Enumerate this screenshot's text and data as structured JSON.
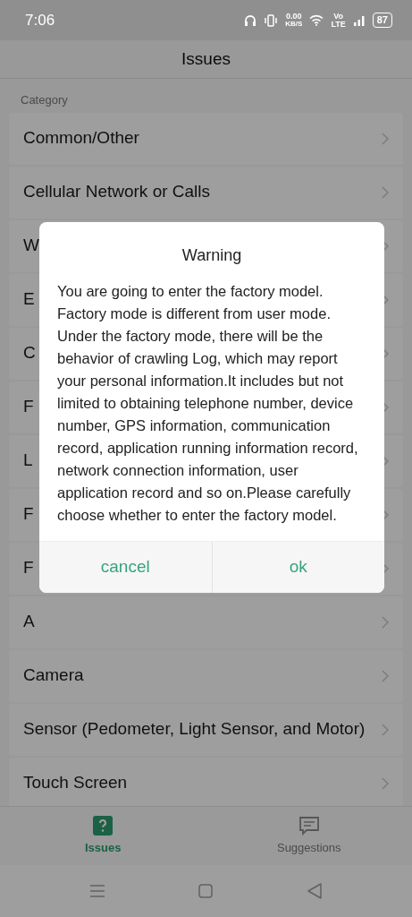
{
  "status_bar": {
    "time": "7:06",
    "speed_value": "0.00",
    "speed_unit": "KB/S",
    "volte_top": "Vo",
    "volte_bottom": "LTE",
    "battery": "87"
  },
  "header": {
    "title": "Issues"
  },
  "section_label": "Category",
  "categories": [
    {
      "label": "Common/Other"
    },
    {
      "label": "Cellular Network or Calls"
    },
    {
      "label": "W"
    },
    {
      "label": "E"
    },
    {
      "label": "C"
    },
    {
      "label": "F"
    },
    {
      "label": "L"
    },
    {
      "label": "F"
    },
    {
      "label": "F"
    },
    {
      "label": "A"
    },
    {
      "label": "Camera"
    },
    {
      "label": "Sensor (Pedometer, Light Sensor, and Motor)"
    },
    {
      "label": "Touch Screen"
    }
  ],
  "dialog": {
    "title": "Warning",
    "message": "You are going to enter the factory model. Factory mode is different from user mode. Under the factory mode, there will be the behavior of crawling Log, which may report your personal information.It includes but not limited to obtaining telephone number, device number, GPS information, communication record, application running information record, network connection information, user application record and so on.Please carefully choose whether to enter the factory model.",
    "buttons": [
      {
        "label": "cancel"
      },
      {
        "label": "ok"
      }
    ]
  },
  "bottom_tabs": [
    {
      "label": "Issues",
      "selected": true
    },
    {
      "label": "Suggestions",
      "selected": false
    }
  ]
}
